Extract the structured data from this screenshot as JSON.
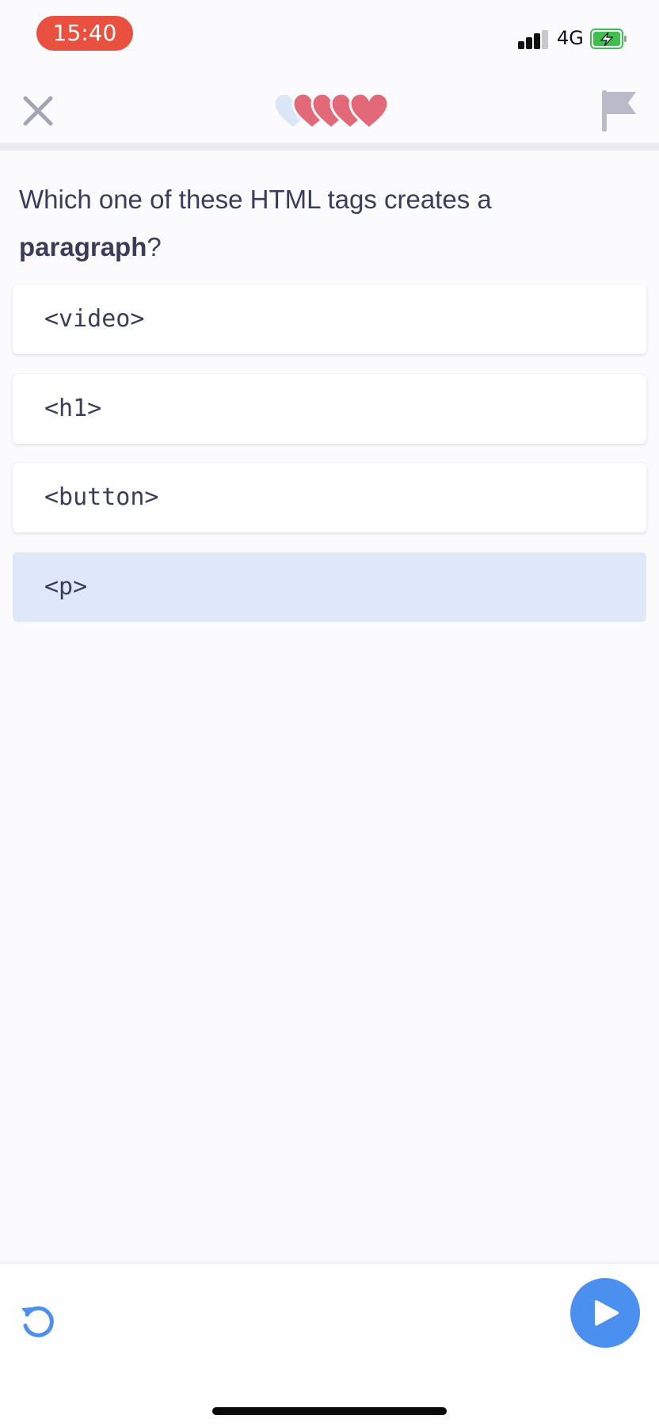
{
  "status_bar": {
    "time": "15:40",
    "network": "4G",
    "time_pill_color": "#e8503f",
    "battery_color": "#3fbf4f"
  },
  "header": {
    "close_icon": "close-icon",
    "hearts": {
      "total": 5,
      "filled": 4,
      "filled_color": "#e26a78",
      "empty_color": "#dbe6f8"
    },
    "flag_icon": "flag-icon"
  },
  "question": {
    "text_before": "Which one of these HTML tags creates a ",
    "emphasis": "paragraph",
    "text_after": "?"
  },
  "options": [
    {
      "label": "<video>",
      "selected": false
    },
    {
      "label": "<h1>",
      "selected": false
    },
    {
      "label": "<button>",
      "selected": false
    },
    {
      "label": "<p>",
      "selected": true
    }
  ],
  "footer": {
    "reset_icon": "reset-icon",
    "run_icon": "play-icon",
    "accent": "#4b90ef"
  }
}
